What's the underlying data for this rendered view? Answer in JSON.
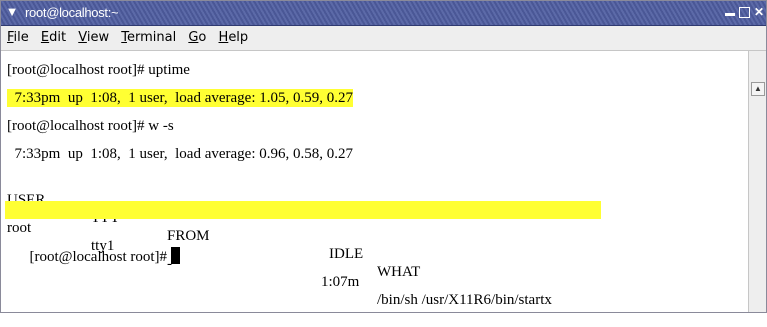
{
  "window": {
    "title": "root@localhost:~",
    "menu_icon": "▼",
    "buttons": {
      "minimize": "_",
      "maximize": "□",
      "close": "✕"
    }
  },
  "menubar": {
    "items": [
      {
        "key": "F",
        "rest": "ile"
      },
      {
        "key": "E",
        "rest": "dit"
      },
      {
        "key": "V",
        "rest": "iew"
      },
      {
        "key": "T",
        "rest": "erminal"
      },
      {
        "key": "G",
        "rest": "o"
      },
      {
        "key": "H",
        "rest": "elp"
      }
    ]
  },
  "terminal": {
    "line1": "[root@localhost root]# uptime",
    "line2": "  7:33pm  up  1:08,  1 user,  load average: 1.05, 0.59, 0.27",
    "line3": "[root@localhost root]# w -s",
    "line4": "  7:33pm  up  1:08,  1 user,  load average: 0.96, 0.58, 0.27",
    "table_headers": [
      "USER",
      "TTY",
      "FROM",
      "IDLE",
      "WHAT"
    ],
    "table_row": [
      "root",
      "tty1",
      "-",
      "1:07m",
      "/bin/sh /usr/X11R6/bin/startx"
    ],
    "prompt": "[root@localhost root]#"
  },
  "colors": {
    "highlight": "#ffff33",
    "titlebar": "#5c6aa8"
  }
}
